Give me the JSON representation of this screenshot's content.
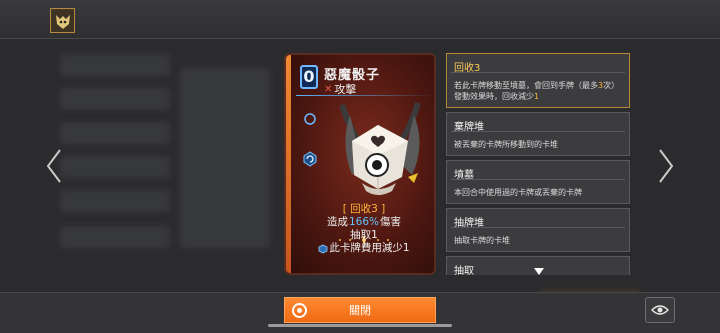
{
  "card": {
    "cost": "0",
    "name": "惡魔骰子",
    "type_label": "攻擊",
    "keyword": "[ 回收3 ]",
    "line1_pre": "造成",
    "line1_value": "166%",
    "line1_post": "傷害",
    "line2": "抽取1",
    "line3": "此卡牌費用減少1"
  },
  "info": [
    {
      "title": "回收3",
      "desc_parts": [
        "若此卡牌移動至墳墓，會回到手牌（最多",
        "3",
        "次）",
        "發動效果時，回收減少",
        "1"
      ]
    },
    {
      "title": "棄牌堆",
      "desc": "被丟棄的卡牌所移動到的卡堆"
    },
    {
      "title": "墳墓",
      "desc": "本回合中使用過的卡牌或丟棄的卡牌"
    },
    {
      "title": "抽牌堆",
      "desc": "抽取卡牌的卡堆"
    },
    {
      "title": "抽取",
      "desc": ""
    }
  ],
  "bottom": {
    "close_label": "關閉"
  },
  "colors": {
    "accent": "#f37a20",
    "keyword": "#ffb43a",
    "highlight": "#62c2ff"
  },
  "icons": [
    "avatar-icon",
    "left-arrow-icon",
    "right-arrow-icon",
    "sword-icon",
    "recycle-icon",
    "eye-icon",
    "down-caret-icon"
  ]
}
